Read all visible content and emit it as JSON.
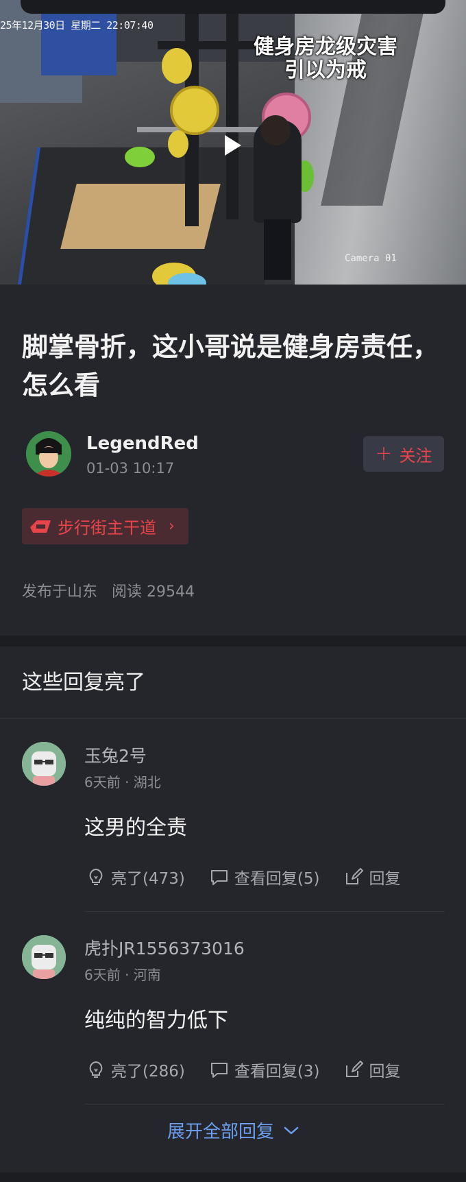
{
  "video": {
    "timestamp": "25年12月30日  星期二  22:07:40",
    "caption_line1": "健身房龙级灾害",
    "caption_line2": "引以为戒",
    "camera_label": "Camera 01"
  },
  "post": {
    "title": "脚掌骨折，这小哥说是健身房责任，怎么看",
    "author": "LegendRed",
    "time": "01-03 10:17",
    "follow_label": "关注",
    "follow_plus": "+",
    "tag_label": "步行街主干道",
    "tag_arrow": "›",
    "published_from": "发布于山东",
    "reads": "阅读 29544"
  },
  "comments_section": {
    "title": "这些回复亮了",
    "items": [
      {
        "user": "玉兔2号",
        "meta": "6天前 · 湖北",
        "text": "这男的全责",
        "like_label": "亮了(473)",
        "replies_label": "查看回复(5)",
        "reply_label": "回复"
      },
      {
        "user": "虎扑JR1556373016",
        "meta": "6天前 · 河南",
        "text": "纯纯的智力低下",
        "like_label": "亮了(286)",
        "replies_label": "查看回复(3)",
        "reply_label": "回复"
      }
    ],
    "expand_label": "展开全部回复"
  },
  "colors": {
    "background": "#25262b",
    "accent_red": "#e8454a",
    "link_blue": "#6c9ff0",
    "muted_text": "#8d8e94"
  },
  "icons": {
    "play": "play-icon",
    "like": "lightbulb-icon",
    "replies": "speech-bubble-icon",
    "reply": "edit-icon",
    "expand": "chevron-down-icon"
  }
}
